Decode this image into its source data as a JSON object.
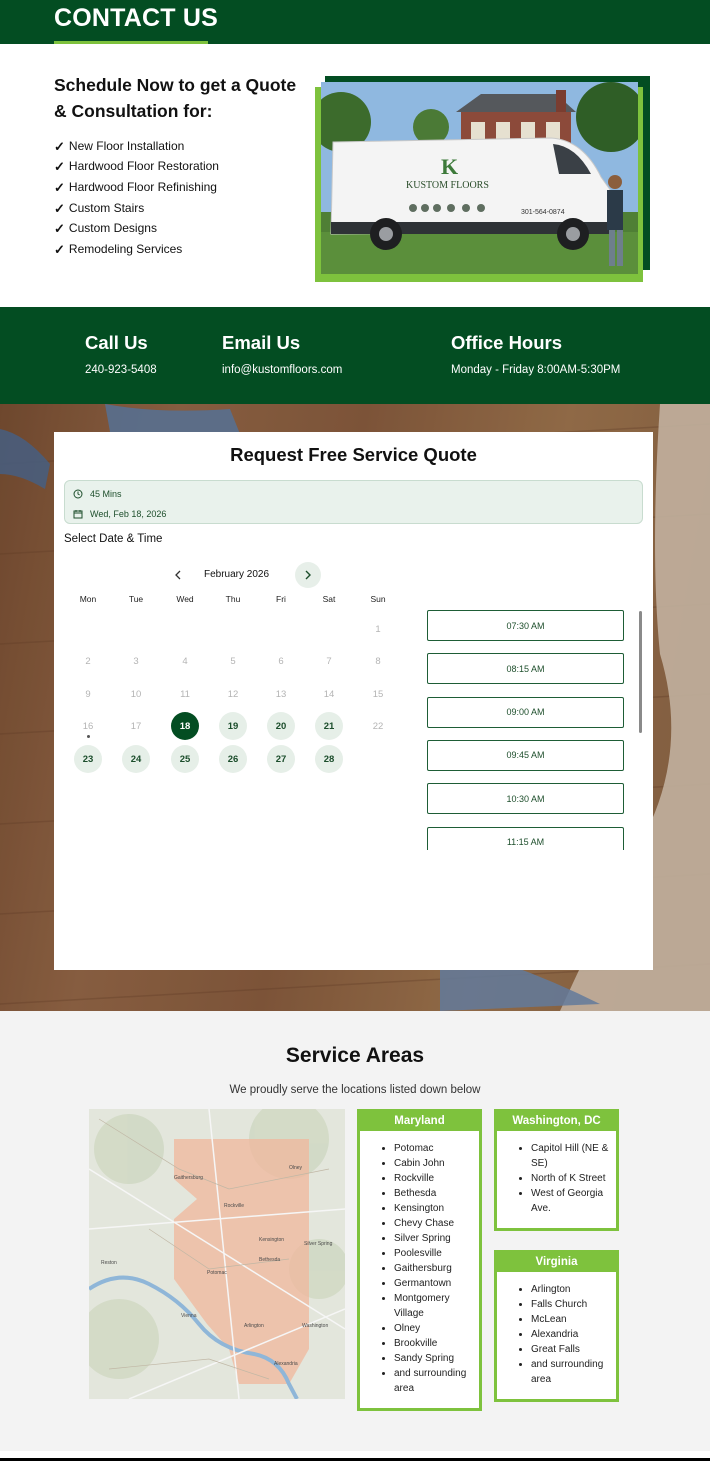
{
  "header": {
    "title": "CONTACT US"
  },
  "intro": {
    "heading": "Schedule Now to get a Quote & Consultation for:",
    "check_glyph": "✓",
    "services": [
      "New Floor Installation",
      "Hardwood Floor Restoration",
      "Hardwood Floor Refinishing",
      "Custom Stairs",
      "Custom Designs",
      "Remodeling Services"
    ],
    "photo": {
      "van_brand": "KUSTOM FLOORS",
      "van_phone": "301-564-0874"
    }
  },
  "contact": {
    "call": {
      "title": "Call Us",
      "value": "240-923-5408"
    },
    "email": {
      "title": "Email Us",
      "value": "info@kustomfloors.com"
    },
    "hours": {
      "title": "Office Hours",
      "value": "Monday - Friday 8:00AM-5:30PM"
    }
  },
  "booking": {
    "title": "Request Free Service Quote",
    "duration": "45 Mins",
    "selected_date": "Wed, Feb 18, 2026",
    "select_label": "Select Date & Time",
    "month": "February 2026",
    "weekdays": [
      "Mon",
      "Tue",
      "Wed",
      "Thu",
      "Fri",
      "Sat",
      "Sun"
    ],
    "days": [
      {
        "d": "1",
        "s": "off"
      },
      {
        "d": "2",
        "s": "off"
      },
      {
        "d": "3",
        "s": "off"
      },
      {
        "d": "4",
        "s": "off"
      },
      {
        "d": "5",
        "s": "off"
      },
      {
        "d": "6",
        "s": "off"
      },
      {
        "d": "7",
        "s": "off"
      },
      {
        "d": "8",
        "s": "off"
      },
      {
        "d": "9",
        "s": "off"
      },
      {
        "d": "10",
        "s": "off"
      },
      {
        "d": "11",
        "s": "off"
      },
      {
        "d": "12",
        "s": "off"
      },
      {
        "d": "13",
        "s": "off"
      },
      {
        "d": "14",
        "s": "off"
      },
      {
        "d": "15",
        "s": "off"
      },
      {
        "d": "16",
        "s": "off",
        "today": true
      },
      {
        "d": "17",
        "s": "off"
      },
      {
        "d": "18",
        "s": "sel"
      },
      {
        "d": "19",
        "s": "avail"
      },
      {
        "d": "20",
        "s": "avail"
      },
      {
        "d": "21",
        "s": "avail"
      },
      {
        "d": "22",
        "s": "off"
      },
      {
        "d": "23",
        "s": "avail"
      },
      {
        "d": "24",
        "s": "avail"
      },
      {
        "d": "25",
        "s": "avail"
      },
      {
        "d": "26",
        "s": "avail"
      },
      {
        "d": "27",
        "s": "avail"
      },
      {
        "d": "28",
        "s": "avail"
      }
    ],
    "slots": [
      "07:30 AM",
      "08:15 AM",
      "09:00 AM",
      "09:45 AM",
      "10:30 AM",
      "11:15 AM"
    ]
  },
  "service_areas": {
    "title": "Service Areas",
    "subtitle": "We proudly serve the locations listed down below",
    "regions": {
      "maryland": {
        "name": "Maryland",
        "items": [
          "Potomac",
          "Cabin John",
          "Rockville",
          "Bethesda",
          "Kensington",
          "Chevy Chase",
          "Silver Spring",
          "Poolesville",
          "Gaithersburg",
          "Germantown",
          "Montgomery Village",
          "Olney",
          "Brookville",
          "Sandy Spring",
          "and surrounding area"
        ]
      },
      "dc": {
        "name": "Washington, DC",
        "items": [
          "Capitol Hill (NE & SE)",
          "North of K Street",
          "West of Georgia Ave."
        ]
      },
      "virginia": {
        "name": "Virginia",
        "items": [
          "Arlington",
          "Falls Church",
          "McLean",
          "Alexandria",
          "Great Falls",
          "and surrounding area"
        ]
      }
    },
    "map_labels": [
      "Gaithersburg",
      "Rockville",
      "Kensington",
      "Silver Spring",
      "Bethesda",
      "Vienna",
      "Arlington",
      "Washington",
      "Alexandria",
      "Potomac",
      "Olney",
      "Reston"
    ]
  },
  "colors": {
    "brand_dark": "#034d22",
    "brand_green": "#7ec23d"
  }
}
